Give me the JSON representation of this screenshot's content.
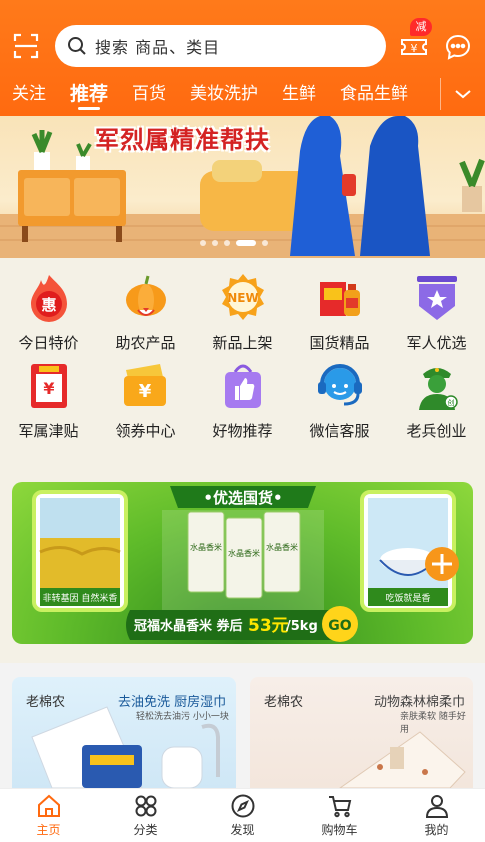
{
  "header": {
    "search_placeholder": "搜索 商品、类目",
    "coupon_badge": "减"
  },
  "tabs": [
    "关注",
    "推荐",
    "百货",
    "美妆洗护",
    "生鲜",
    "食品生鲜"
  ],
  "active_tab": "推荐",
  "banner": {
    "title": "军烈属精准帮扶",
    "dot_count": 6,
    "active_dot": 4
  },
  "grid": [
    {
      "label": "今日特价",
      "icon": "hui-flame-icon"
    },
    {
      "label": "助农产品",
      "icon": "pumpkin-icon"
    },
    {
      "label": "新品上架",
      "icon": "new-badge-icon"
    },
    {
      "label": "国货精品",
      "icon": "gift-box-icon"
    },
    {
      "label": "军人优选",
      "icon": "star-shield-icon"
    },
    {
      "label": "军属津贴",
      "icon": "yuan-certificate-icon"
    },
    {
      "label": "领券中心",
      "icon": "yuan-ticket-icon"
    },
    {
      "label": "好物推荐",
      "icon": "thumbs-up-bag-icon"
    },
    {
      "label": "微信客服",
      "icon": "headset-icon"
    },
    {
      "label": "老兵创业",
      "icon": "soldier-icon"
    }
  ],
  "promo": {
    "header": "•优选国货•",
    "left_caption": "非转基因 自然米香",
    "right_caption": "吃饭就是香",
    "bag_text": "水晶香米",
    "offer_prefix": "冠福水晶香米 券后",
    "offer_price": "53元",
    "offer_suffix": "/5kg",
    "go_label": "GO"
  },
  "cards": [
    {
      "brand": "老棉农",
      "title": "去油免洗 厨房湿巾",
      "sub": "轻松洗去油污 小小一块"
    },
    {
      "brand": "老棉农",
      "title": "动物森林棉柔巾",
      "sub": "亲肤柔软 随手好用"
    }
  ],
  "bottom_nav": [
    {
      "label": "主页",
      "icon": "home-icon"
    },
    {
      "label": "分类",
      "icon": "category-icon"
    },
    {
      "label": "发现",
      "icon": "compass-icon"
    },
    {
      "label": "购物车",
      "icon": "cart-icon"
    },
    {
      "label": "我的",
      "icon": "user-icon"
    }
  ],
  "active_nav": "主页",
  "colors": {
    "brand": "#ff6a10",
    "promo_green": "#5fbb2a",
    "price_yellow": "#ffe600"
  }
}
